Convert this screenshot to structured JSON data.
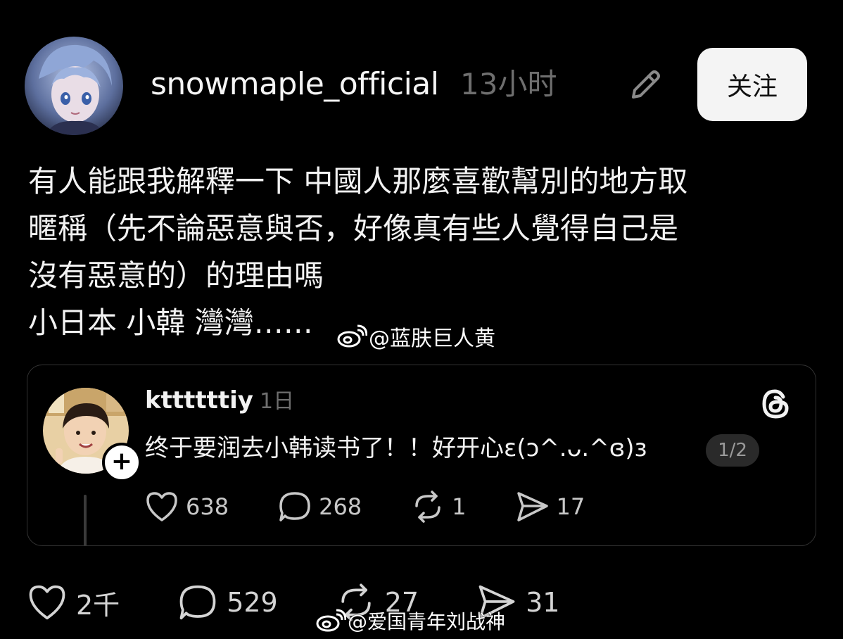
{
  "post": {
    "username": "snowmaple_official",
    "time": "13小时",
    "follow_label": "关注",
    "body_lines": [
      "有人能跟我解釋一下 中國人那麼喜歡幫別的地方取",
      "暱稱（先不論惡意與否，好像真有些人覺得自己是",
      "沒有惡意的）的理由嗎",
      "小日本 小韓 灣灣……"
    ],
    "stats": {
      "likes": "2千",
      "comments": "529",
      "reposts": "27",
      "shares": "31"
    }
  },
  "quoted": {
    "username": "kttttttiy",
    "time": "1日",
    "text": "终于要润去小韩读书了！！好开心ɛ(ɔ^.ᴗ.^ɞ)ɜ",
    "page": "1/2",
    "stats": {
      "likes": "638",
      "comments": "268",
      "reposts": "1",
      "shares": "17"
    }
  },
  "watermarks": {
    "top": "@蓝肤巨人黄",
    "bottom": "@爱国青年刘战神"
  },
  "icons": {
    "edit": "pencil-icon",
    "like": "heart-icon",
    "comment": "comment-bubble-icon",
    "repost": "repost-icon",
    "share": "send-icon",
    "threads": "threads-logo-icon",
    "weibo": "weibo-logo-icon"
  },
  "colors": {
    "background": "#000000",
    "text": "#f2f2f2",
    "muted": "#6e6e6e",
    "follow_button_bg": "#f4f4f4",
    "card_border": "#333333"
  }
}
